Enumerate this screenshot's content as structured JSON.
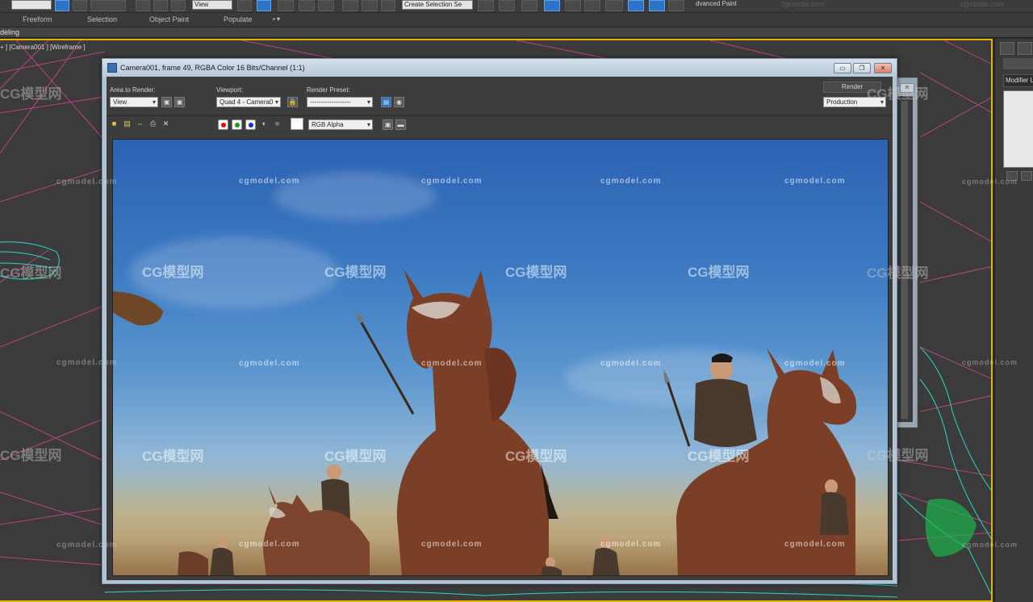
{
  "toolbar": {
    "field_left": "",
    "field_view": "View",
    "field_named": "Create Selection Se",
    "advanced_paint": "dvanced Paint",
    "watermark": "cgmodel.com"
  },
  "ribbon": {
    "tabs": [
      "Freeform",
      "Selection",
      "Object Paint",
      "Populate"
    ],
    "dropdown_glyph": "▪ ▾",
    "sub_label": "deling"
  },
  "viewport": {
    "label": "+ ] [Camera001 ] [Wireframe ]"
  },
  "command_panel": {
    "modifier_list": "Modifier Li"
  },
  "render_window": {
    "title": "Camera001, frame 49, RGBA Color 16 Bits/Channel (1:1)",
    "area_to_render_label": "Area to Render:",
    "area_to_render_value": "View",
    "viewport_label": "Viewport:",
    "viewport_value": "Quad 4 - Camera0",
    "render_preset_label": "Render Preset:",
    "render_preset_value": "-------------------",
    "render_button": "Render",
    "production_value": "Production",
    "channel_value": "RGB Alpha",
    "minimize": "▭",
    "restore": "❐",
    "close": "✕"
  },
  "watermarks": {
    "latin": "cgmodel.com",
    "cn": "CG模型网"
  },
  "colors": {
    "accent_active": "#2d74c9",
    "viewport_border": "#e0b300",
    "wireframe_pink": "#d0448f",
    "wireframe_cyan": "#27d8c4",
    "sky_top": "#2d62b3"
  }
}
